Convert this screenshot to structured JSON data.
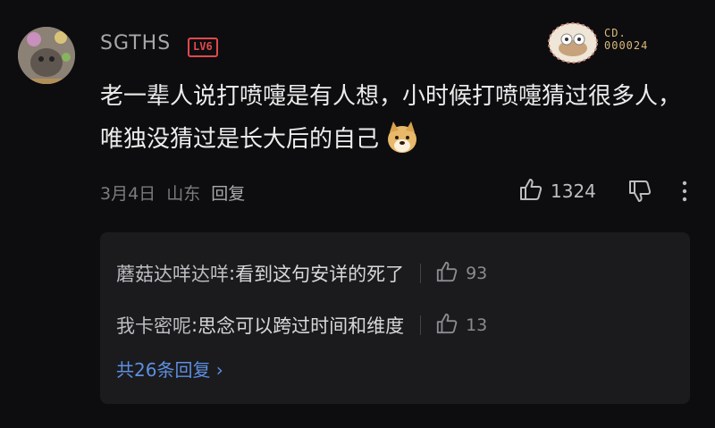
{
  "comment": {
    "username": "SGTHS",
    "level": "LV6",
    "fan_badge_number": "CD.\n000024",
    "text": "老一辈人说打喷嚏是有人想，小时候打喷嚏猜过很多人，唯独没猜过是长大后的自己",
    "date": "3月4日",
    "location": "山东",
    "reply_label": "回复",
    "like_count": "1324",
    "emoji_icon": "doge-emoji-icon"
  },
  "replies": [
    {
      "author": "蘑菇达咩达咩",
      "text": "看到这句安详的死了",
      "likes": "93"
    },
    {
      "author": "我卡密呢",
      "text": "思念可以跨过时间和维度",
      "likes": "13"
    }
  ],
  "view_more": "共26条回复 ›",
  "colors": {
    "background": "#0d0d0f",
    "level_red": "#e2484d",
    "link_blue": "#5d8fe0"
  }
}
